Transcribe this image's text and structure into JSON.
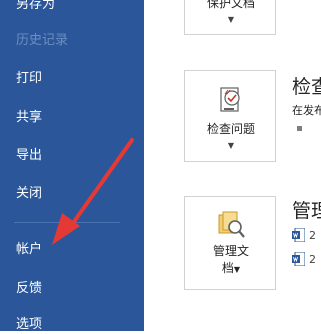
{
  "sidebar": {
    "items": [
      {
        "label": "另存为",
        "disabled": false
      },
      {
        "label": "历史记录",
        "disabled": true
      },
      {
        "label": "打印",
        "disabled": false
      },
      {
        "label": "共享",
        "disabled": false
      },
      {
        "label": "导出",
        "disabled": false
      },
      {
        "label": "关闭",
        "disabled": false
      },
      {
        "label": "帐户",
        "disabled": false
      },
      {
        "label": "反馈",
        "disabled": false
      },
      {
        "label": "选项",
        "disabled": false
      }
    ]
  },
  "main": {
    "protect": {
      "label": "保护文档"
    },
    "inspect": {
      "label": "检查问题",
      "section_title": "检查",
      "section_desc": "在发布"
    },
    "manage": {
      "label_line1": "管理文",
      "label_line2": "档",
      "section_title": "管理",
      "versions": [
        "2",
        "2"
      ]
    }
  },
  "colors": {
    "sidebar_bg": "#2b579a",
    "arrow": "#e53935",
    "word_blue": "#2b579a"
  }
}
